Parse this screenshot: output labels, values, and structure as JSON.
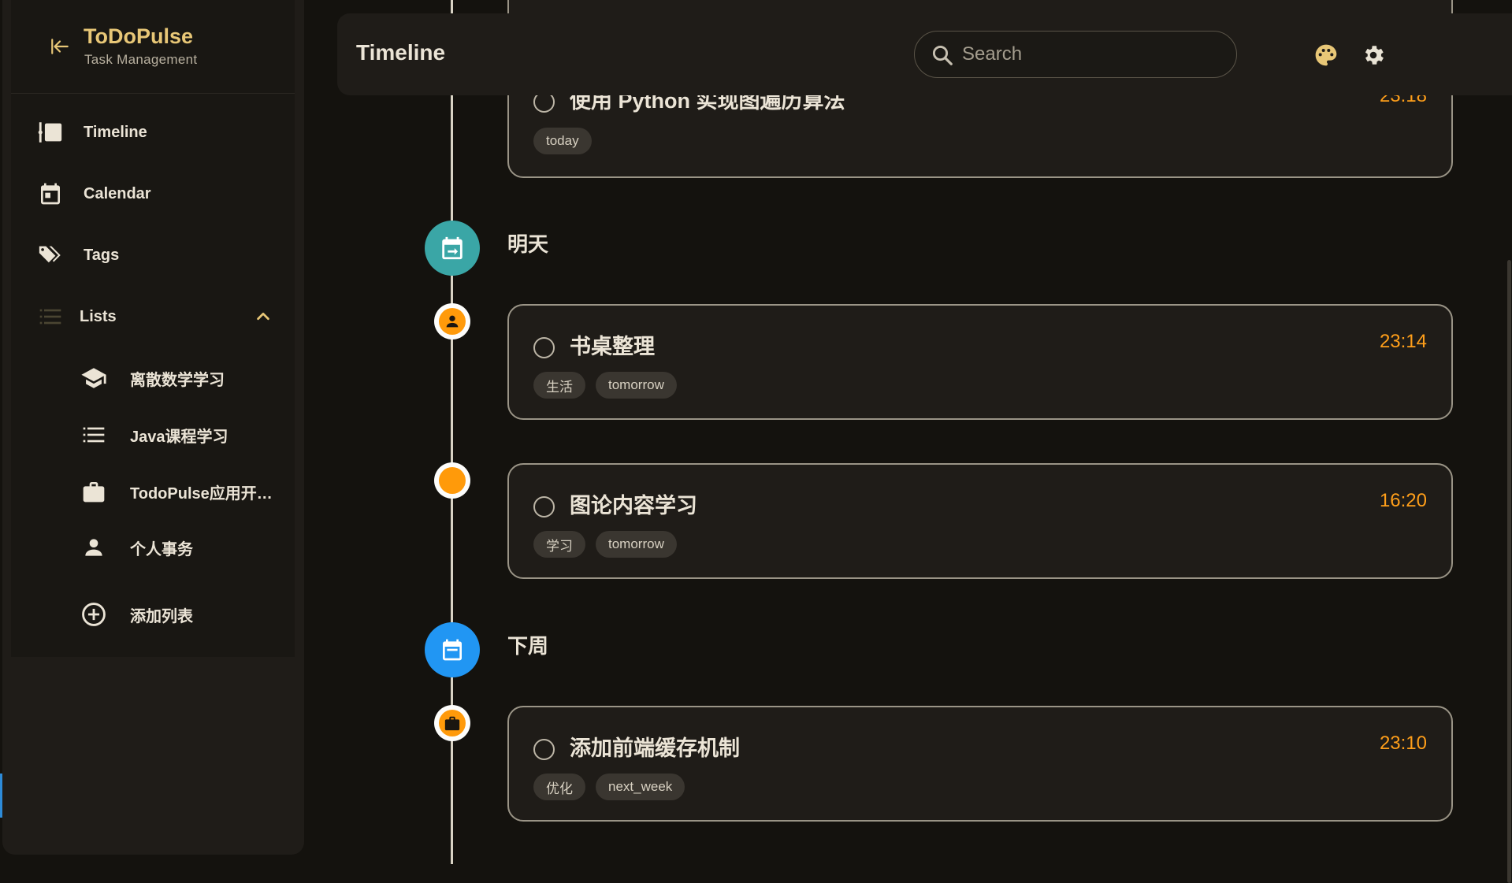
{
  "app": {
    "name": "ToDoPulse",
    "subtitle": "Task Management"
  },
  "sidebar": {
    "nav": [
      {
        "label": "Timeline",
        "icon": "timeline-icon"
      },
      {
        "label": "Calendar",
        "icon": "calendar-icon"
      },
      {
        "label": "Tags",
        "icon": "tags-icon"
      },
      {
        "label": "Lists",
        "icon": "list-icon"
      }
    ],
    "lists": [
      {
        "label": "离散数学学习",
        "icon": "graduation-cap-icon"
      },
      {
        "label": "Java课程学习",
        "icon": "list-icon"
      },
      {
        "label": "TodoPulse应用开…",
        "icon": "briefcase-icon"
      },
      {
        "label": "个人事务",
        "icon": "person-icon"
      }
    ],
    "add_list_label": "添加列表"
  },
  "header": {
    "title": "Timeline",
    "search_placeholder": "Search"
  },
  "timeline": {
    "partial_task": {
      "title": "使用 Python 实现图遍历算法",
      "time": "23:18",
      "tags": [
        "today"
      ]
    },
    "groups": [
      {
        "title": "明天",
        "color": "#3aa6a6",
        "icon": "calendar-arrow-icon",
        "tasks": [
          {
            "title": "书桌整理",
            "time": "23:14",
            "tags": [
              "生活",
              "tomorrow"
            ],
            "icon": "person-icon"
          },
          {
            "title": "图论内容学习",
            "time": "16:20",
            "tags": [
              "学习",
              "tomorrow"
            ],
            "icon": "none"
          }
        ]
      },
      {
        "title": "下周",
        "color": "#2196f3",
        "icon": "calendar-week-icon",
        "tasks": [
          {
            "title": "添加前端缓存机制",
            "time": "23:10",
            "tags": [
              "优化",
              "next_week"
            ],
            "icon": "briefcase-icon"
          }
        ]
      }
    ]
  },
  "colors": {
    "accent": "#e8c777",
    "time": "#ff9f1a",
    "task_dot": "#ff9a0a",
    "background": "#14120e"
  }
}
